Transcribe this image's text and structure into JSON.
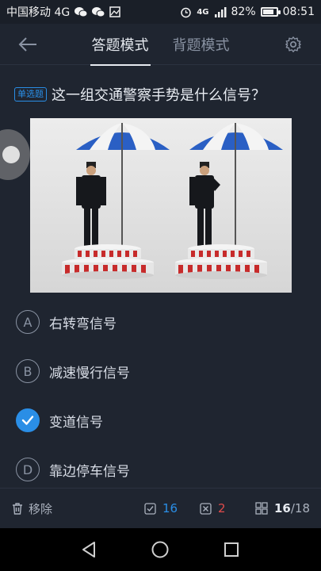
{
  "status_bar": {
    "carrier": "中国移动 4G",
    "network_badge": "4G",
    "battery_percent": "82%",
    "battery_level": 0.82,
    "time": "08:51",
    "left_icons": [
      "wechat-icon",
      "wechat-icon",
      "image-icon"
    ],
    "right_icons": [
      "alarm-icon",
      "signal-icon",
      "battery-icon"
    ]
  },
  "header": {
    "tabs": [
      {
        "label": "答题模式",
        "active": true
      },
      {
        "label": "背题模式",
        "active": false
      }
    ]
  },
  "question": {
    "type_badge": "单选题",
    "text": "这一组交通警察手势是什么信号？"
  },
  "options": [
    {
      "letter": "A",
      "text": "右转弯信号",
      "selected": false
    },
    {
      "letter": "B",
      "text": "减速慢行信号",
      "selected": false
    },
    {
      "letter": "",
      "text": "变道信号",
      "selected": true
    },
    {
      "letter": "D",
      "text": "靠边停车信号",
      "selected": false
    }
  ],
  "toolbar": {
    "remove_label": "移除",
    "correct_count": "16",
    "wrong_count": "2",
    "progress_current": "16",
    "progress_total": "/18"
  },
  "colors": {
    "background": "#1f2530",
    "accent": "#2a8ee6",
    "wrong": "#e04b4b"
  }
}
